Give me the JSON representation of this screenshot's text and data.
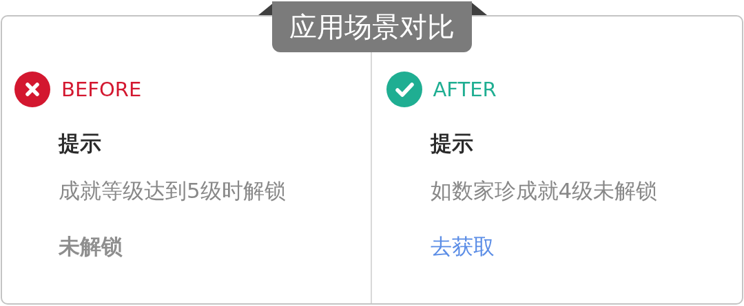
{
  "title": "应用场景对比",
  "panels": [
    {
      "kind": "before",
      "label": "BEFORE",
      "color": "#d3172f",
      "heading": "提示",
      "description": "成就等级达到5级时解锁",
      "action": {
        "kind": "status",
        "text": "未解锁"
      }
    },
    {
      "kind": "after",
      "label": "AFTER",
      "color": "#1fae92",
      "heading": "提示",
      "description": "如数家珍成就4级未解锁",
      "action": {
        "kind": "link",
        "text": "去获取"
      }
    }
  ]
}
